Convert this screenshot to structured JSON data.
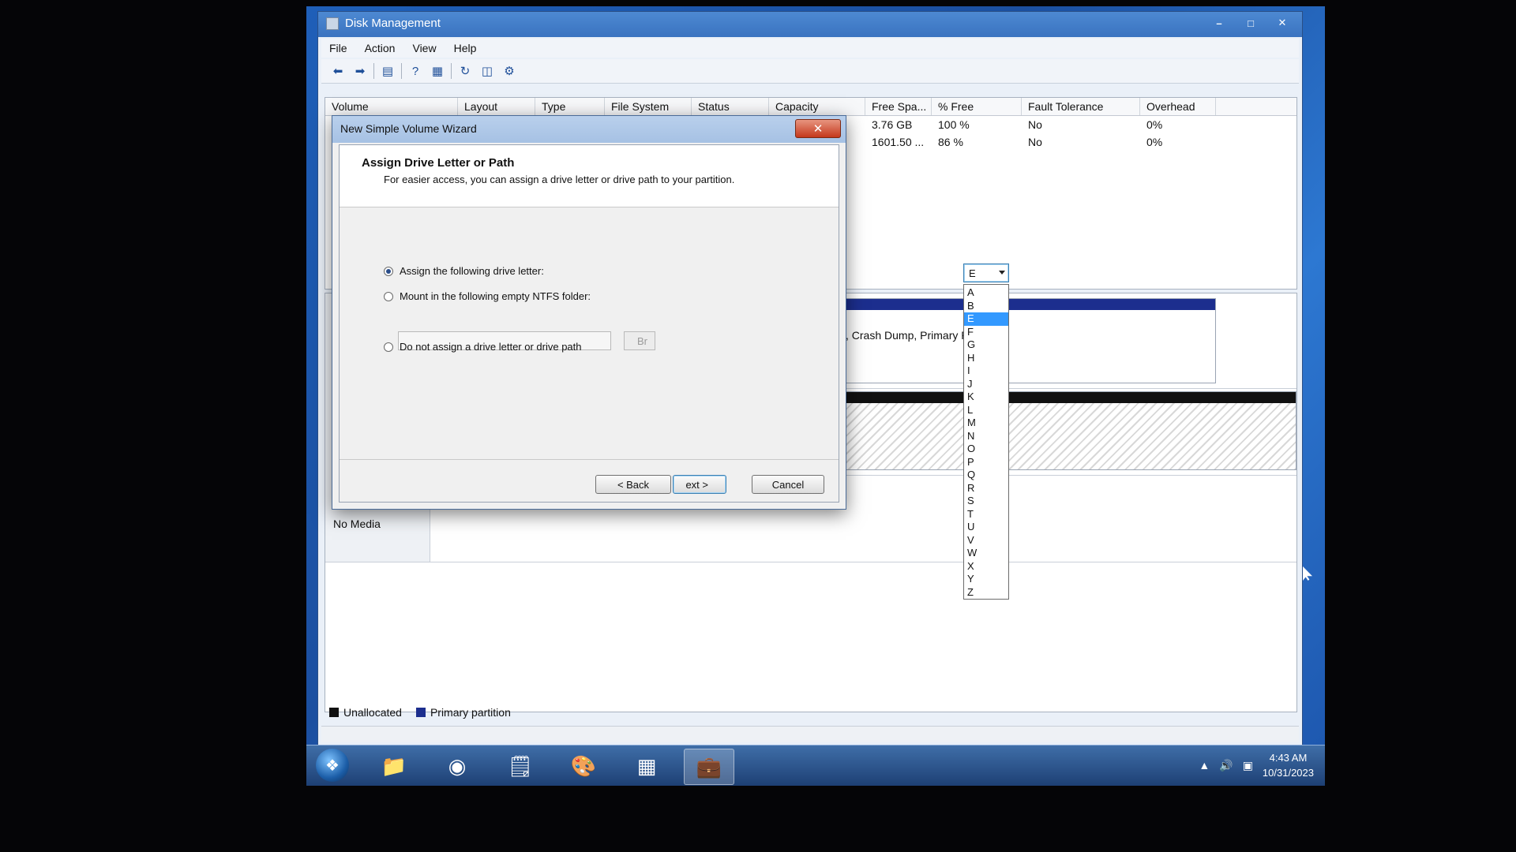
{
  "window": {
    "title": "Disk Management",
    "menu": [
      "File",
      "Action",
      "View",
      "Help"
    ]
  },
  "toolbar": {
    "icons": [
      "back-arrow-icon",
      "forward-arrow-icon",
      "console-tree-icon",
      "help-icon",
      "properties-icon",
      "refresh-icon",
      "rescan-icon",
      "settings-icon"
    ]
  },
  "volume_table": {
    "headers": [
      "Volume",
      "Layout",
      "Type",
      "File System",
      "Status",
      "Capacity",
      "Free Spa...",
      "% Free",
      "Fault Tolerance",
      "Overhead"
    ],
    "rows": [
      [
        "",
        "",
        "",
        "",
        "",
        "",
        "3.76 GB",
        "100 %",
        "No",
        "0%"
      ],
      [
        "",
        "",
        "",
        "",
        "",
        "",
        "1601.50 ...",
        "86 %",
        "No",
        "0%"
      ]
    ]
  },
  "graphical": {
    "partition_text": ", Crash Dump, Primary Partition)",
    "no_media": "No Media"
  },
  "legend": {
    "unallocated": "Unallocated",
    "primary": "Primary partition"
  },
  "colors": {
    "unallocated": "#111111",
    "primary": "#1c2e8e",
    "selection": "#3399ff"
  },
  "wizard": {
    "title": "New Simple Volume Wizard",
    "heading": "Assign Drive Letter or Path",
    "subheading": "For easier access, you can assign a drive letter or drive path to your partition.",
    "option_assign": "Assign the following drive letter:",
    "option_mount": "Mount in the following empty NTFS folder:",
    "option_none": "Do not assign a drive letter or drive path",
    "browse_label": "Br",
    "back_label": "< Back",
    "next_label": "ext >",
    "cancel_label": "Cancel",
    "selected_letter": "E",
    "letters": [
      "A",
      "B",
      "E",
      "F",
      "G",
      "H",
      "I",
      "J",
      "K",
      "L",
      "M",
      "N",
      "O",
      "P",
      "Q",
      "R",
      "S",
      "T",
      "U",
      "V",
      "W",
      "X",
      "Y",
      "Z"
    ]
  },
  "taskbar": {
    "apps": [
      "file-explorer-icon",
      "firefox-icon",
      "notepad-icon",
      "paint-icon",
      "control-panel-icon",
      "computer-management-icon"
    ],
    "time": "4:43 AM",
    "date": "10/31/2023"
  }
}
